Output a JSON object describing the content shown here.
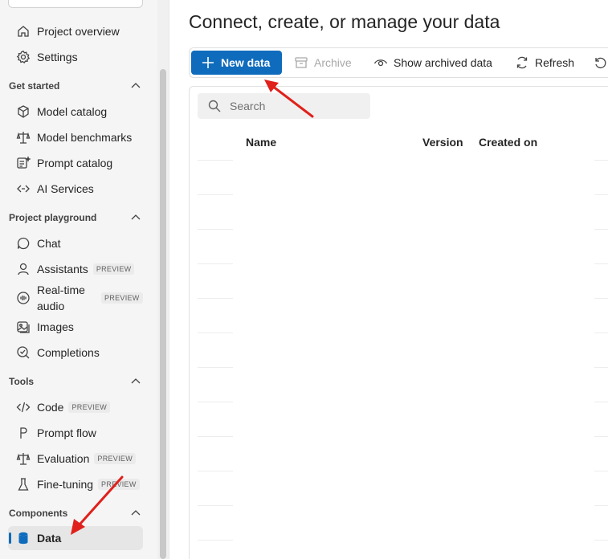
{
  "sidebar": {
    "top_items": [
      {
        "label": "Project overview",
        "icon": "home-icon"
      },
      {
        "label": "Settings",
        "icon": "gear-icon"
      }
    ],
    "sections": [
      {
        "title": "Get started",
        "items": [
          {
            "label": "Model catalog",
            "icon": "cube-icon",
            "badge": ""
          },
          {
            "label": "Model benchmarks",
            "icon": "scales-icon",
            "badge": ""
          },
          {
            "label": "Prompt catalog",
            "icon": "sparkle-list-icon",
            "badge": ""
          },
          {
            "label": "AI Services",
            "icon": "link-icon",
            "badge": ""
          }
        ]
      },
      {
        "title": "Project playground",
        "items": [
          {
            "label": "Chat",
            "icon": "chat-icon",
            "badge": ""
          },
          {
            "label": "Assistants",
            "icon": "assistant-icon",
            "badge": "PREVIEW"
          },
          {
            "label": "Real-time audio",
            "icon": "audio-icon",
            "badge": "PREVIEW"
          },
          {
            "label": "Images",
            "icon": "image-icon",
            "badge": ""
          },
          {
            "label": "Completions",
            "icon": "completions-icon",
            "badge": ""
          }
        ]
      },
      {
        "title": "Tools",
        "items": [
          {
            "label": "Code",
            "icon": "code-icon",
            "badge": "PREVIEW"
          },
          {
            "label": "Prompt flow",
            "icon": "flow-icon",
            "badge": ""
          },
          {
            "label": "Evaluation",
            "icon": "scales-icon",
            "badge": "PREVIEW"
          },
          {
            "label": "Fine-tuning",
            "icon": "flask-icon",
            "badge": "PREVIEW"
          }
        ]
      },
      {
        "title": "Components",
        "items": [
          {
            "label": "Data",
            "icon": "database-icon",
            "badge": "",
            "active": true
          }
        ]
      }
    ]
  },
  "main": {
    "title": "Connect, create, or manage your data",
    "toolbar": {
      "new_data": "New data",
      "archive": "Archive",
      "show_archived": "Show archived data",
      "refresh": "Refresh"
    },
    "search_placeholder": "Search",
    "columns": [
      "Name",
      "Version",
      "Created on"
    ]
  },
  "colors": {
    "accent": "#0f6cbd",
    "annotation_arrow": "#e0201b"
  }
}
